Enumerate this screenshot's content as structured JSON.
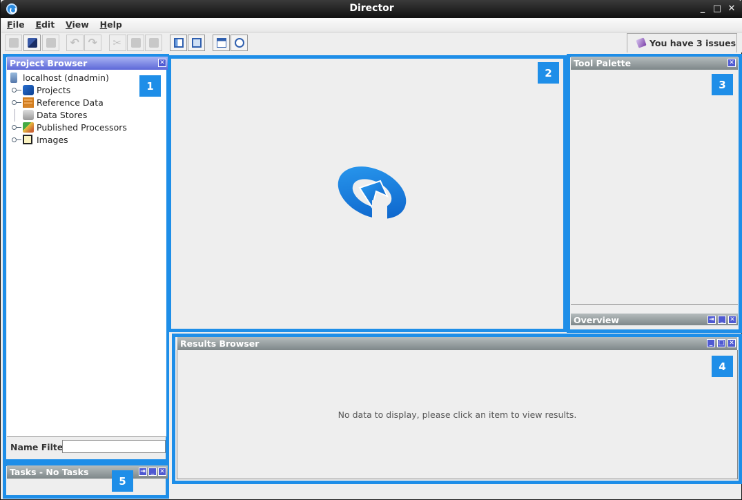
{
  "window": {
    "title": "Director",
    "controls": [
      "minimize",
      "maximize",
      "close"
    ]
  },
  "menubar": [
    {
      "label": "File",
      "mnemonic": "F",
      "rest": "ile"
    },
    {
      "label": "Edit",
      "mnemonic": "E",
      "rest": "dit"
    },
    {
      "label": "View",
      "mnemonic": "V",
      "rest": "iew"
    },
    {
      "label": "Help",
      "mnemonic": "H",
      "rest": "elp"
    }
  ],
  "toolbar": {
    "buttons": [
      {
        "name": "save",
        "icon": "floppy-disk-icon",
        "enabled": false
      },
      {
        "name": "save-all",
        "icon": "save-all-icon",
        "enabled": true
      },
      {
        "name": "print",
        "icon": "print-icon",
        "enabled": false
      },
      {
        "name": "undo",
        "icon": "undo-icon",
        "enabled": false
      },
      {
        "name": "redo",
        "icon": "redo-icon",
        "enabled": false
      },
      {
        "name": "cut",
        "icon": "scissors-icon",
        "enabled": false
      },
      {
        "name": "copy",
        "icon": "copy-icon",
        "enabled": false
      },
      {
        "name": "paste",
        "icon": "paste-icon",
        "enabled": false
      },
      {
        "name": "layout",
        "icon": "layout-icon",
        "enabled": true
      },
      {
        "name": "fit-canvas",
        "icon": "fit-icon",
        "enabled": true
      },
      {
        "name": "calendar",
        "icon": "calendar-icon",
        "enabled": true
      },
      {
        "name": "find",
        "icon": "magnifier-icon",
        "enabled": true
      }
    ],
    "issues_label": "You have 3 issues"
  },
  "highlight_color": "#1e8ee8",
  "project_browser": {
    "title": "Project Browser",
    "badge": "1",
    "root": "localhost (dnadmin)",
    "items": [
      {
        "label": "Projects",
        "icon": "projects-icon",
        "expandable": true
      },
      {
        "label": "Reference Data",
        "icon": "reference-data-icon",
        "expandable": true
      },
      {
        "label": "Data Stores",
        "icon": "data-stores-icon",
        "expandable": false
      },
      {
        "label": "Published Processors",
        "icon": "published-processors-icon",
        "expandable": true
      },
      {
        "label": "Images",
        "icon": "images-icon",
        "expandable": true
      }
    ],
    "name_filter_label": "Name Filter",
    "name_filter_value": ""
  },
  "canvas": {
    "badge": "2"
  },
  "tool_palette": {
    "title": "Tool Palette",
    "badge": "3"
  },
  "overview": {
    "title": "Overview"
  },
  "results_browser": {
    "title": "Results Browser",
    "badge": "4",
    "empty_message": "No data to display, please click an item to view results."
  },
  "tasks": {
    "title": "Tasks - No Tasks",
    "badge": "5"
  }
}
